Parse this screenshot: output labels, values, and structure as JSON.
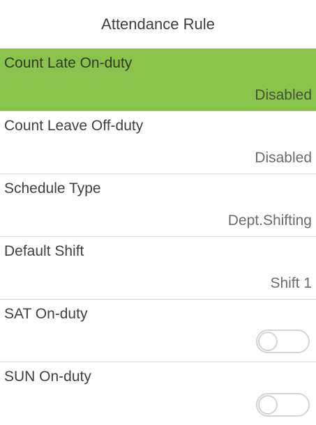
{
  "header": {
    "title": "Attendance Rule"
  },
  "rows": [
    {
      "label": "Count Late On-duty",
      "value": "Disabled",
      "type": "value",
      "selected": true
    },
    {
      "label": "Count Leave Off-duty",
      "value": "Disabled",
      "type": "value",
      "selected": false
    },
    {
      "label": "Schedule Type",
      "value": "Dept.Shifting",
      "type": "value",
      "selected": false
    },
    {
      "label": "Default Shift",
      "value": "Shift 1",
      "type": "value",
      "selected": false
    },
    {
      "label": "SAT On-duty",
      "type": "toggle",
      "state": "off",
      "selected": false
    },
    {
      "label": "SUN On-duty",
      "type": "toggle",
      "state": "off",
      "selected": false
    }
  ],
  "colors": {
    "selected_background": "#89c34c",
    "divider": "#d9d9d9",
    "text_primary": "#3f3f3f",
    "text_secondary": "#6b6b6b"
  }
}
